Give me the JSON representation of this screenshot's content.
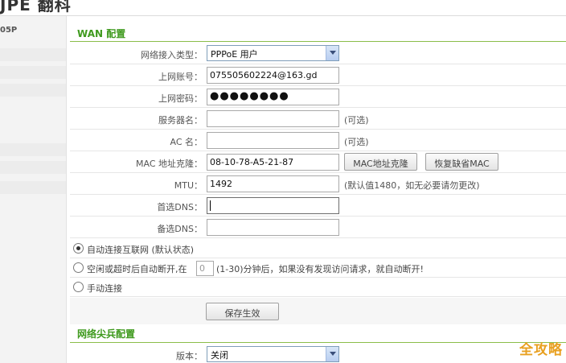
{
  "header": {
    "logo_text": "JPE 翻科"
  },
  "sidebar": {
    "model": "05P"
  },
  "wan": {
    "title": "WAN 配置",
    "conn_type": {
      "label": "网络接入类型：",
      "value": "PPPoE 用户"
    },
    "account": {
      "label": "上网账号：",
      "value": "075505602224@163.gd"
    },
    "password": {
      "label": "上网密码：",
      "value": "●●●●●●●●"
    },
    "server": {
      "label": "服务器名：",
      "value": "",
      "hint": "(可选)"
    },
    "ac": {
      "label": "AC 名：",
      "value": "",
      "hint": "(可选)"
    },
    "mac": {
      "label": "MAC 地址克隆：",
      "value": "08-10-78-A5-21-87",
      "clone_btn": "MAC地址克隆",
      "restore_btn": "恢复缺省MAC"
    },
    "mtu": {
      "label": "MTU：",
      "value": "1492",
      "hint": "(默认值1480，如无必要请勿更改)"
    },
    "dns1": {
      "label": "首选DNS：",
      "value": ""
    },
    "dns2": {
      "label": "备选DNS：",
      "value": ""
    },
    "options": {
      "auto": "自动连接互联网 (默认状态)",
      "idle_prefix": "空闲或超时后自动断开,在",
      "idle_value": "0",
      "idle_suffix": "(1-30)分钟后，如果没有发现访问请求，就自动断开!",
      "manual": "手动连接"
    },
    "save_btn": "保存生效"
  },
  "sentinel": {
    "title": "网络尖兵配置",
    "version": {
      "label": "版本：",
      "value": "关闭"
    }
  },
  "watermark": "全攻略"
}
